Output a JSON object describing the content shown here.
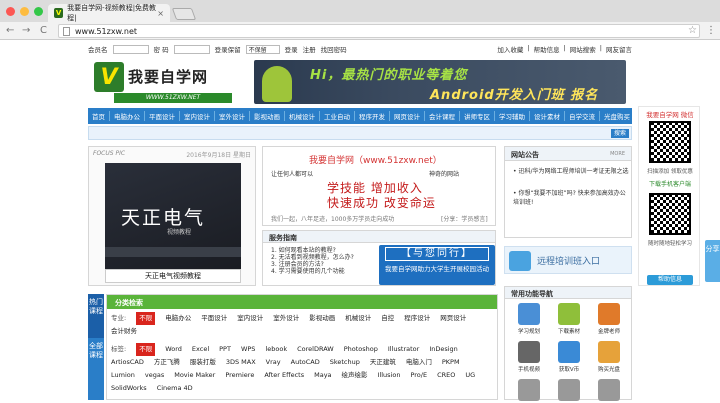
{
  "browser": {
    "tab_title": "我要自学网-视频教程|免费教程|",
    "tab_close": "×",
    "url": "www.51zxw.net",
    "back": "←",
    "forward": "→",
    "reload": "C",
    "star": "☆",
    "menu": "⋮",
    "colors": {
      "red": "#fc5753",
      "yellow": "#fdbc40",
      "green": "#33c748"
    }
  },
  "topbar": {
    "member_label": "会员名",
    "password_label": "密 码",
    "login_label": "登录保留",
    "login_option": "不保留",
    "login_link": "登录",
    "register_link": "注册",
    "forgot_link": "找回密码",
    "right_links": [
      "加入收藏",
      "帮助信息",
      "网站搜索",
      "网友留言"
    ]
  },
  "logo": {
    "mark": "V",
    "title": "我要自学网",
    "url": "WWW.51ZXW.NET"
  },
  "ad": {
    "line1": "Hi，最热门的职业等着您",
    "line2": "Android开发入门班   报名吧！"
  },
  "nav": [
    "首页",
    "电脑办公",
    "平面设计",
    "室内设计",
    "室外设计",
    "影视动画",
    "机械设计",
    "工业自动",
    "程序开发",
    "网页设计",
    "会计课程",
    "讲师专区",
    "学习辅助",
    "设计素材",
    "自学交流",
    "光盘购买"
  ],
  "search": {
    "button": "搜索"
  },
  "focus": {
    "head": "FOCUS PIC",
    "date": "2016年9月18日 星期日",
    "image_title": "天正电气",
    "image_sub": "视频教程",
    "caption": "天正电气视频教程"
  },
  "center": {
    "title": "我要自学网（www.51zxw.net）",
    "slogan_left": "让任何人都可以",
    "slogan_right": "神奇的网站",
    "big1": "学技能  增加收入",
    "big2": "快速成功  改变命运",
    "footer": "我们一起，八年足迹，1000多万学员走向成功",
    "footer_right": "[分享：学员感言]"
  },
  "service": {
    "title": "服务指南",
    "items": [
      "1. 如何观看本站的教程?",
      "2. 无法看到视频教程，怎么办?",
      "3. 注册会员的方法?",
      "4. 学习需要使用的几个功能"
    ],
    "banner1": "【与您同行】",
    "banner2": "我要自学网助力大学生开展校园活动"
  },
  "notice": {
    "title": "网站公告",
    "more": "MORE",
    "items": [
      "• 迅科/华为网络工程师培训一考证无限之选",
      "• 你想“我要不加班”吗? 快来参加高效办公培训班!"
    ]
  },
  "remote": {
    "text": "远程培训班入口"
  },
  "common": {
    "title": "常用功能导航",
    "items": [
      {
        "label": "学习规划",
        "color": "#4a8fd6"
      },
      {
        "label": "下载素材",
        "color": "#8fbf3a"
      },
      {
        "label": "金牌老师",
        "color": "#e07a2a"
      },
      {
        "label": "手机视频",
        "color": "#666666"
      },
      {
        "label": "获取V币",
        "color": "#3a8ad6"
      },
      {
        "label": "购买光盘",
        "color": "#e6a23a"
      },
      {
        "label": "",
        "color": "#999999"
      },
      {
        "label": "",
        "color": "#999999"
      },
      {
        "label": "",
        "color": "#999999"
      }
    ]
  },
  "hot": {
    "a": "热门课程",
    "b": "全部课程"
  },
  "categories": {
    "title": "分类检索",
    "major_label": "专业:",
    "major": [
      "不限",
      "电脑办公",
      "平面设计",
      "室内设计",
      "室外设计",
      "影视动画",
      "机械设计",
      "自控",
      "程序设计",
      "网页设计",
      "会计财务"
    ],
    "tag_label": "标签:",
    "tags": [
      "不限",
      "Word",
      "Excel",
      "PPT",
      "WPS",
      "lebook",
      "CorelDRAW",
      "Photoshop",
      "Illustrator",
      "InDesign",
      "ArtiosCAD",
      "方正飞腾",
      "服装打版",
      "3DS MAX",
      "Vray",
      "AutoCAD",
      "Sketchup",
      "天正建筑",
      "电脑入门",
      "PKPM",
      "Lumion",
      "vegas",
      "Movie Maker",
      "Premiere",
      "After Effects",
      "Maya",
      "绘声绘影",
      "Illusion",
      "Pro/E",
      "CREO",
      "UG",
      "SolidWorks",
      "Cinema 4D"
    ]
  },
  "sidead": {
    "title": "我要自学网 微信",
    "caption1": "扫描添加  领取优惠",
    "caption2": "下载手机客户端",
    "caption3": "随时随地轻松学习",
    "help": "帮助信息"
  },
  "share": "分享"
}
